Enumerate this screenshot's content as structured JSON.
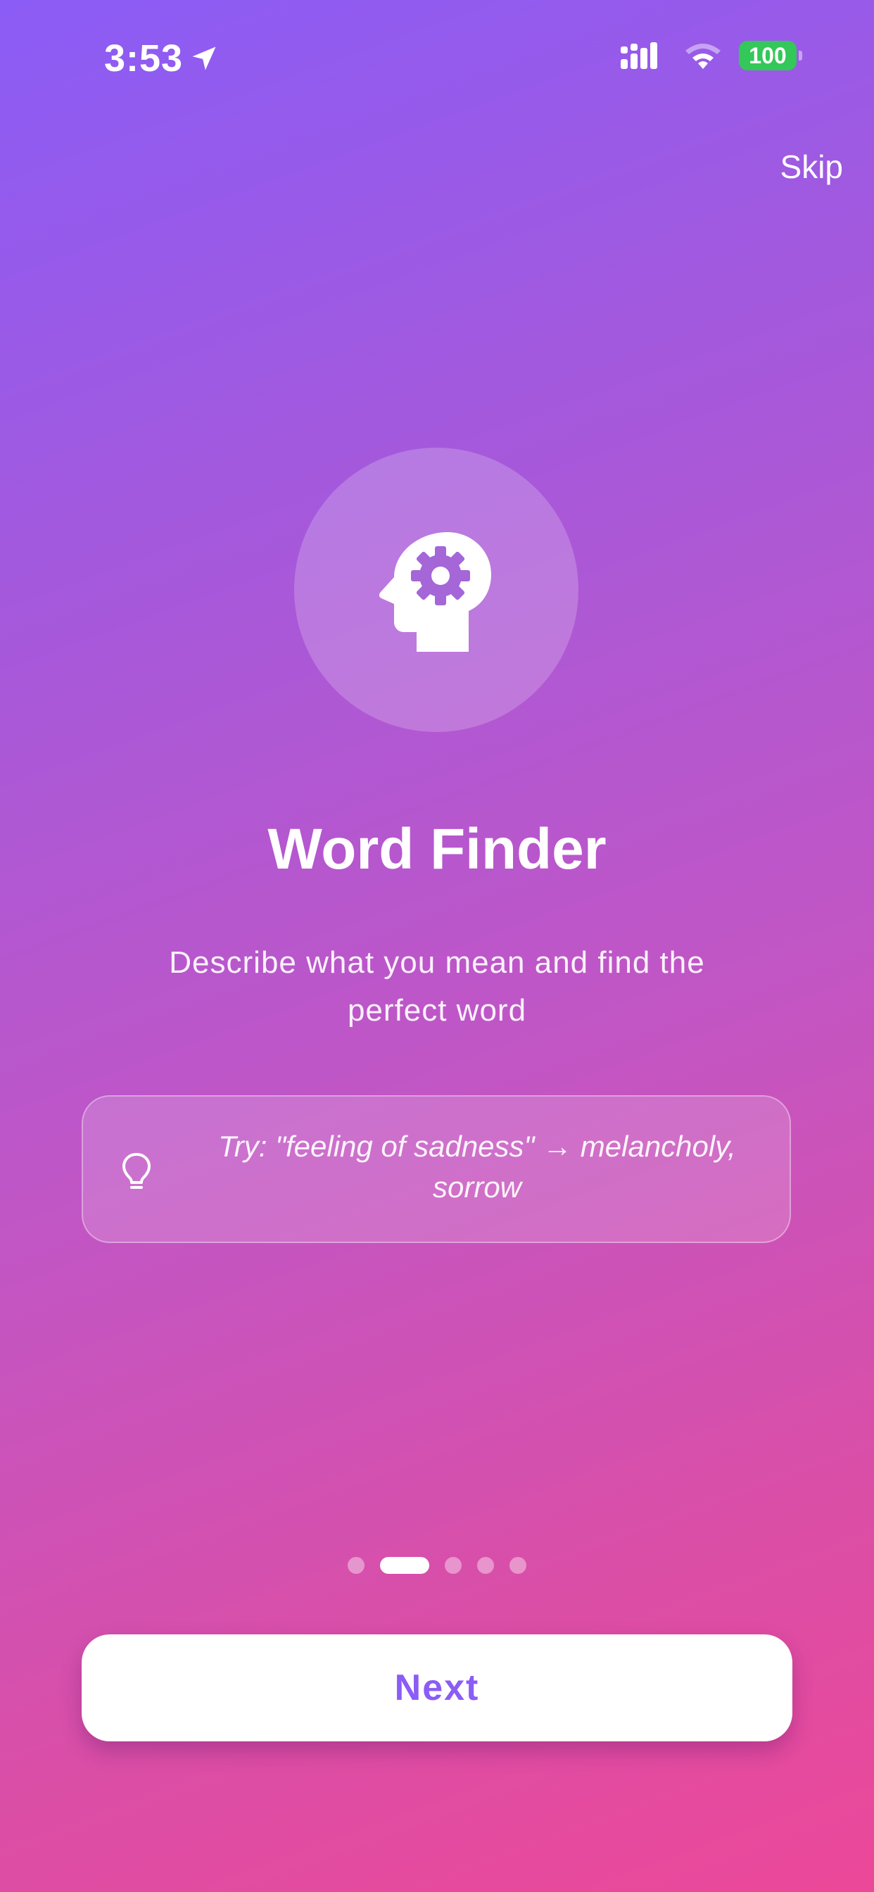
{
  "status_bar": {
    "time": "3:53",
    "battery": "100",
    "icons": [
      "location-arrow-icon",
      "signal-icon",
      "wifi-icon",
      "battery-icon"
    ]
  },
  "header": {
    "skip_label": "Skip"
  },
  "hero": {
    "icon": "head-gear-icon",
    "title": "Word Finder",
    "subtitle": "Describe what you mean and find the perfect word"
  },
  "example": {
    "icon": "lightbulb-icon",
    "text": "Try: \"feeling of sadness\" → melancholy, sorrow"
  },
  "pager": {
    "total": 5,
    "current": 2
  },
  "footer": {
    "next_label": "Next"
  },
  "colors": {
    "gradient_start": "#8b5cf6",
    "gradient_end": "#ec4899",
    "accent": "#8b5cf6",
    "battery": "#34c759"
  }
}
